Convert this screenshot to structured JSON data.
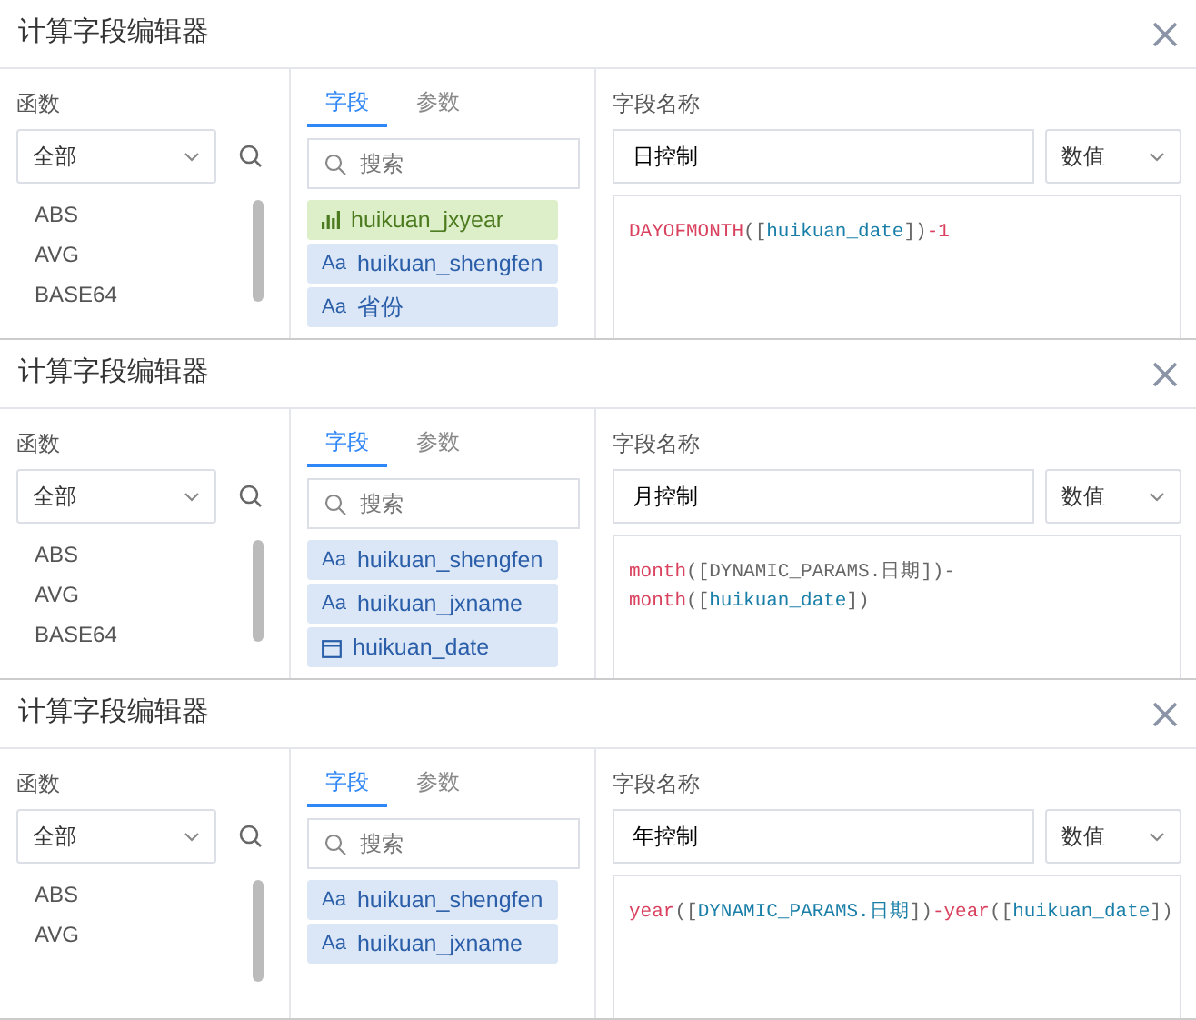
{
  "dialogs": [
    {
      "title": "计算字段编辑器",
      "functions_label": "函数",
      "category": "全部",
      "functions": [
        "ABS",
        "AVG",
        "BASE64"
      ],
      "tabs": [
        {
          "label": "字段",
          "selected": true
        },
        {
          "label": "参数",
          "selected": false
        }
      ],
      "search": {
        "placeholder": "搜索"
      },
      "fields": [
        {
          "kind": "measure",
          "name": "huikuan_jxyear"
        },
        {
          "kind": "dimension",
          "badge": "Aa",
          "name": "huikuan_shengfen"
        },
        {
          "kind": "dimension",
          "badge": "Aa",
          "name": "省份"
        }
      ],
      "name_label": "字段名称",
      "name_value": "日控制",
      "value_type": "数值",
      "formula": [
        [
          {
            "kind": "function",
            "text": "DAYOFMONTH"
          },
          {
            "kind": "text",
            "text": "(["
          },
          {
            "kind": "field",
            "text": "huikuan_date"
          },
          {
            "kind": "text",
            "text": "])"
          },
          {
            "kind": "function",
            "text": "-1"
          }
        ]
      ]
    },
    {
      "title": "计算字段编辑器",
      "functions_label": "函数",
      "category": "全部",
      "functions": [
        "ABS",
        "AVG",
        "BASE64"
      ],
      "tabs": [
        {
          "label": "字段",
          "selected": true
        },
        {
          "label": "参数",
          "selected": false
        }
      ],
      "search": {
        "placeholder": "搜索"
      },
      "fields": [
        {
          "kind": "dimension",
          "badge": "Aa",
          "name": "huikuan_shengfen"
        },
        {
          "kind": "dimension",
          "badge": "Aa",
          "name": "huikuan_jxname"
        },
        {
          "kind": "date",
          "name": "huikuan_date"
        }
      ],
      "name_label": "字段名称",
      "name_value": "月控制",
      "value_type": "数值",
      "formula": [
        [
          {
            "kind": "function",
            "text": "month"
          },
          {
            "kind": "text",
            "text": "([DYNAMIC_PARAMS.日期])-"
          }
        ],
        [
          {
            "kind": "function",
            "text": "month"
          },
          {
            "kind": "text",
            "text": "(["
          },
          {
            "kind": "field",
            "text": "huikuan_date"
          },
          {
            "kind": "text",
            "text": "])"
          }
        ]
      ]
    },
    {
      "title": "计算字段编辑器",
      "functions_label": "函数",
      "category": "全部",
      "functions": [
        "ABS",
        "AVG"
      ],
      "tabs": [
        {
          "label": "字段",
          "selected": true
        },
        {
          "label": "参数",
          "selected": false
        }
      ],
      "search": {
        "placeholder": "搜索"
      },
      "fields": [
        {
          "kind": "dimension",
          "badge": "Aa",
          "name": "huikuan_shengfen"
        },
        {
          "kind": "dimension",
          "badge": "Aa",
          "name": "huikuan_jxname"
        }
      ],
      "name_label": "字段名称",
      "name_value": "年控制",
      "value_type": "数值",
      "formula": [
        [
          {
            "kind": "function",
            "text": "year"
          },
          {
            "kind": "text",
            "text": "(["
          },
          {
            "kind": "field",
            "text": "DYNAMIC_PARAMS.日期"
          },
          {
            "kind": "text",
            "text": "])"
          },
          {
            "kind": "function",
            "text": "-year"
          },
          {
            "kind": "text",
            "text": "(["
          },
          {
            "kind": "field",
            "text": "huikuan_date"
          },
          {
            "kind": "text",
            "text": "])"
          }
        ]
      ]
    }
  ]
}
